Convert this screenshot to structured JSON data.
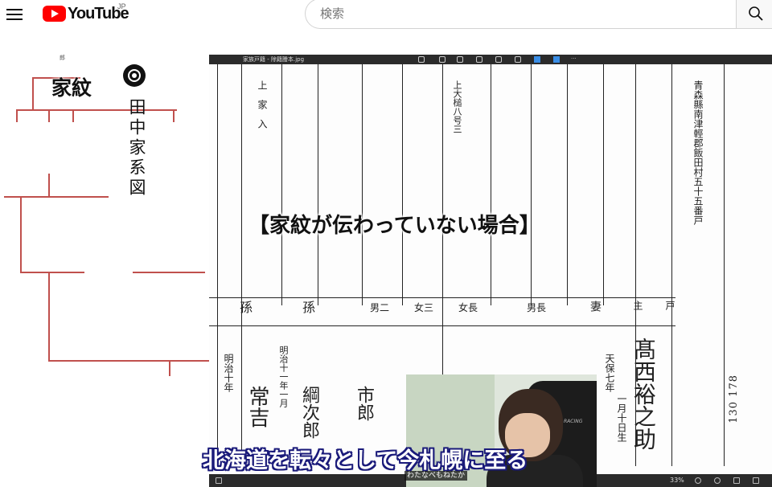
{
  "masthead": {
    "logo_text": "YouTube",
    "region": "JP",
    "search_placeholder": "検索"
  },
  "video": {
    "tree": {
      "top_label": "郎",
      "kamon_title": "家紋",
      "kakeizu_title": "田中家系図"
    },
    "document": {
      "toolbar_title": "家族戸籍 - 除籍謄本.jpg",
      "zoom": "33%",
      "header_columns": [
        "孫",
        "孫",
        "男二",
        "女三",
        "女長",
        "男長",
        "妻",
        "主",
        "戸"
      ],
      "right_block": "青森縣南津輕郡飯田村五十五番戸",
      "name_main": "髙西裕之助",
      "doc_number": "130 178",
      "text_columns": [
        "常吉",
        "綱次郎",
        "市郎",
        "明治十年",
        "明治十一年一月",
        "天保七年",
        "一月十日生"
      ]
    },
    "caption_top": "【家紋が伝わっていない場合】",
    "caption_bottom": "北海道を転々として今札幌に至る",
    "speaker": "わたなべもねたか",
    "webcam_brand": "RACING"
  }
}
